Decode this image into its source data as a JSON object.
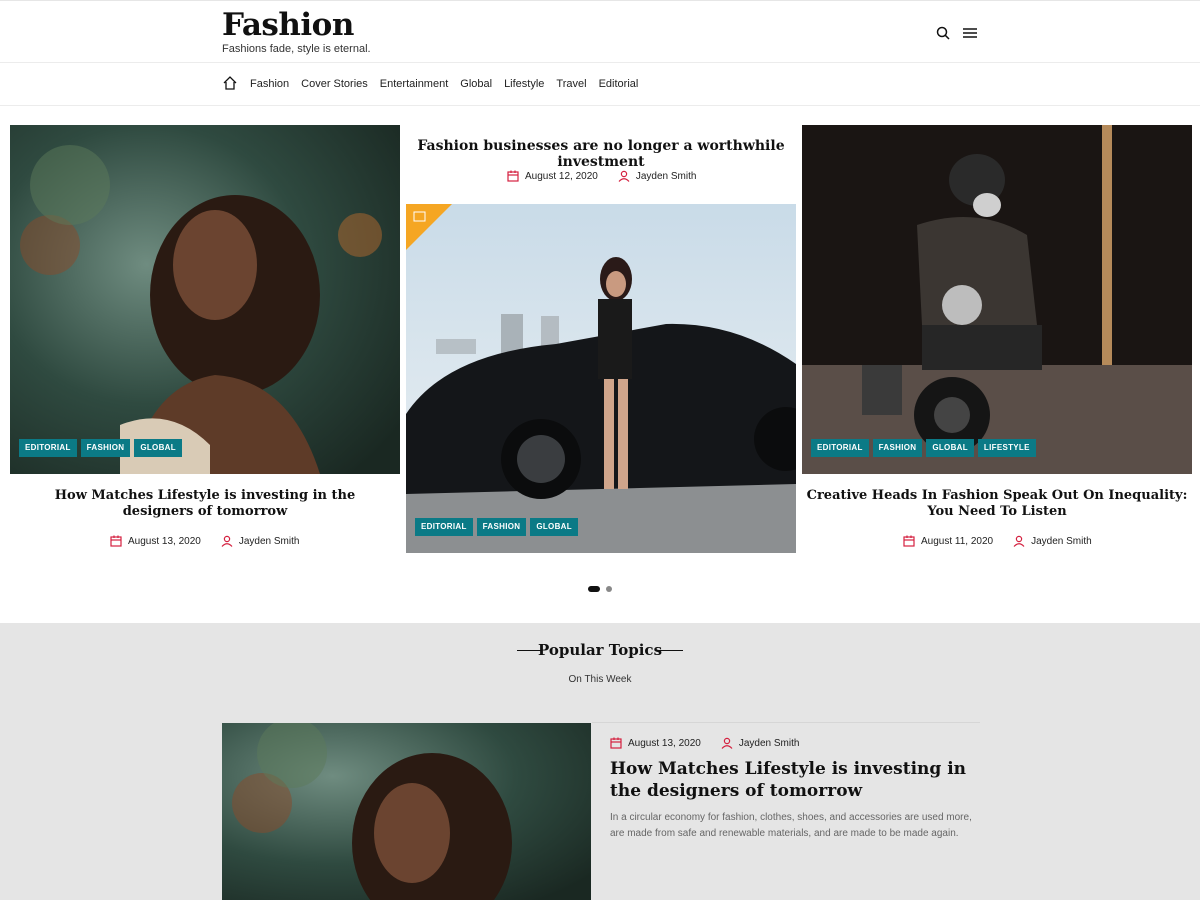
{
  "site": {
    "title": "Fashion",
    "tagline": "Fashions fade, style is eternal."
  },
  "header_icons": [
    "search-icon",
    "menu-icon"
  ],
  "nav": {
    "items": [
      "Fashion",
      "Cover Stories",
      "Entertainment",
      "Global",
      "Lifestyle",
      "Travel",
      "Editorial"
    ]
  },
  "colors": {
    "accent": "#0b7a86",
    "meta_icon": "#d4203f",
    "corner": "#f5a623",
    "section_bg": "#e5e5e5"
  },
  "slides": [
    {
      "title": "How Matches Lifestyle is investing in the designers of tomorrow",
      "date": "August 13, 2020",
      "author": "Jayden Smith",
      "badges": [
        "EDITORIAL",
        "FASHION",
        "GLOBAL"
      ]
    },
    {
      "title": "Fashion businesses are no longer a worthwhile investment",
      "date": "August 12, 2020",
      "author": "Jayden Smith",
      "badges": [
        "EDITORIAL",
        "FASHION",
        "GLOBAL"
      ]
    },
    {
      "title": "Creative Heads In Fashion Speak Out On Inequality: You Need To Listen",
      "date": "August 11, 2020",
      "author": "Jayden Smith",
      "badges": [
        "EDITORIAL",
        "FASHION",
        "GLOBAL",
        "LIFESTYLE"
      ]
    }
  ],
  "popular": {
    "title": "Popular Topics",
    "subtitle": "On This Week",
    "post": {
      "date": "August 13, 2020",
      "author": "Jayden Smith",
      "title": "How Matches Lifestyle is investing in the designers of tomorrow",
      "excerpt": "In a circular economy for fashion, clothes, shoes, and accessories are used more, are made from safe and renewable materials, and are made to be made again."
    }
  }
}
